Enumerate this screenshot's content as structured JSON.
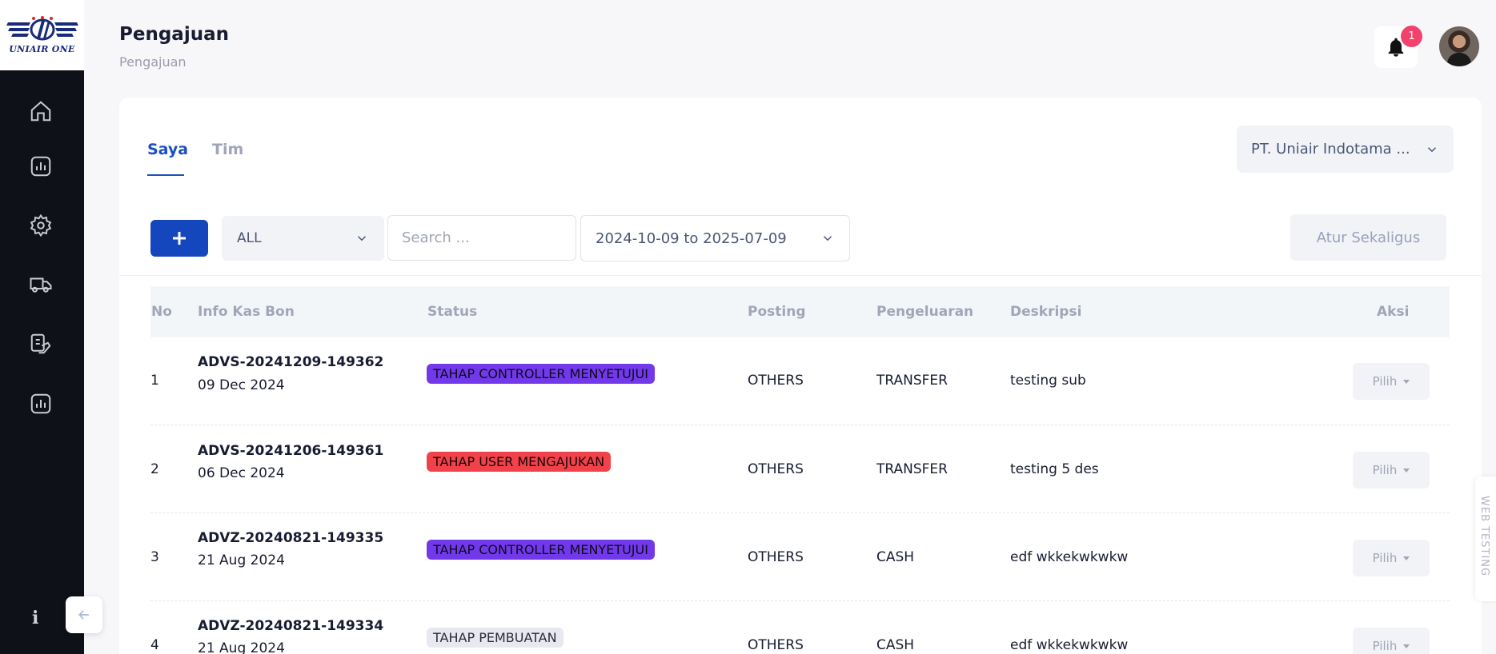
{
  "logo": {
    "text": "UNIAIR ONE"
  },
  "sidebar": {
    "items": [
      {
        "name": "home"
      },
      {
        "name": "chart"
      },
      {
        "name": "settings"
      },
      {
        "name": "truck"
      },
      {
        "name": "payment"
      },
      {
        "name": "report"
      }
    ],
    "info_label": "i"
  },
  "header": {
    "title": "Pengajuan",
    "breadcrumb": "Pengajuan",
    "notification_count": "1"
  },
  "tabs": [
    {
      "label": "Saya",
      "active": true
    },
    {
      "label": "Tim",
      "active": false
    }
  ],
  "company_select": {
    "value": "PT. Uniair Indotama ..."
  },
  "filters": {
    "type_value": "ALL",
    "search_placeholder": "Search ...",
    "date_range": "2024-10-09 to 2025-07-09",
    "bulk_button": "Atur Sekaligus"
  },
  "table": {
    "headers": {
      "no": "No",
      "info": "Info Kas Bon",
      "status": "Status",
      "posting": "Posting",
      "pengeluaran": "Pengeluaran",
      "deskripsi": "Deskripsi",
      "aksi": "Aksi"
    },
    "rows": [
      {
        "no": "1",
        "code": "ADVS-20241209-149362",
        "date": "09 Dec 2024",
        "status": "TAHAP CONTROLLER MENYETUJUI",
        "status_color": "#7239ea",
        "posting": "OTHERS",
        "pengeluaran": "TRANSFER",
        "deskripsi": "testing sub",
        "action": "Pilih"
      },
      {
        "no": "2",
        "code": "ADVS-20241206-149361",
        "date": "06 Dec 2024",
        "status": "TAHAP USER MENGAJUKAN",
        "status_color": "#f1414a",
        "posting": "OTHERS",
        "pengeluaran": "TRANSFER",
        "deskripsi": "testing 5 des",
        "action": "Pilih"
      },
      {
        "no": "3",
        "code": "ADVZ-20240821-149335",
        "date": "21 Aug 2024",
        "status": "TAHAP CONTROLLER MENYETUJUI",
        "status_color": "#7239ea",
        "posting": "OTHERS",
        "pengeluaran": "CASH",
        "deskripsi": "edf wkkekwkwkw",
        "action": "Pilih"
      },
      {
        "no": "4",
        "code": "ADVZ-20240821-149334",
        "date": "21 Aug 2024",
        "status": "TAHAP PEMBUATAN",
        "status_color": "#e8e8f0",
        "posting": "OTHERS",
        "pengeluaran": "CASH",
        "deskripsi": "edf wkkekwkwkw",
        "action": "Pilih"
      }
    ]
  },
  "side_tab": {
    "label": "WEB TESTING"
  },
  "colors": {
    "primary": "#1447bd",
    "sidebar_bg": "#0e1117",
    "badge": "#f1416c"
  }
}
